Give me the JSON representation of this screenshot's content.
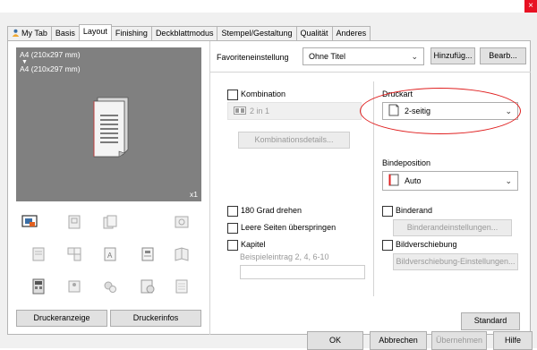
{
  "window": {
    "close_glyph": "×"
  },
  "tabs": [
    {
      "label": "My Tab",
      "icon": "user-icon"
    },
    {
      "label": "Basis"
    },
    {
      "label": "Layout",
      "active": true
    },
    {
      "label": "Finishing"
    },
    {
      "label": "Deckblattmodus"
    },
    {
      "label": "Stempel/Gestaltung"
    },
    {
      "label": "Qualität"
    },
    {
      "label": "Anderes"
    }
  ],
  "preview": {
    "original_size": "A4 (210x297 mm)",
    "arrow": "▼",
    "output_size": "A4 (210x297 mm)",
    "copies": "x1"
  },
  "left_buttons": {
    "druckeranzeige": "Druckeranzeige",
    "druckerinfos": "Druckerinfos"
  },
  "favorites": {
    "label": "Favoriteneinstellung",
    "value": "Ohne Titel",
    "add": "Hinzufüg...",
    "edit": "Bearb..."
  },
  "kombination": {
    "checkbox": "Kombination",
    "select_value": "2 in 1",
    "details_button": "Kombinationsdetails..."
  },
  "druckart": {
    "label": "Druckart",
    "value": "2-seitig"
  },
  "bindeposition": {
    "label": "Bindeposition",
    "value": "Auto"
  },
  "options_left": {
    "rotate": "180 Grad drehen",
    "skip_blank": "Leere Seiten überspringen",
    "chapter": "Kapitel",
    "chapter_hint": "Beispieleintrag 2, 4, 6-10"
  },
  "options_right": {
    "binderand": "Binderand",
    "binderand_button": "Binderandeinstellungen...",
    "bildverschiebung": "Bildverschiebung",
    "bildverschiebung_button": "Bildverschiebung-Einstellungen..."
  },
  "standard_button": "Standard",
  "footer": {
    "ok": "OK",
    "cancel": "Abbrechen",
    "apply": "Übernehmen",
    "help": "Hilfe"
  },
  "colors": {
    "highlight_ring": "#e02020",
    "preview_bg": "#808080",
    "close_bg": "#e81123"
  }
}
